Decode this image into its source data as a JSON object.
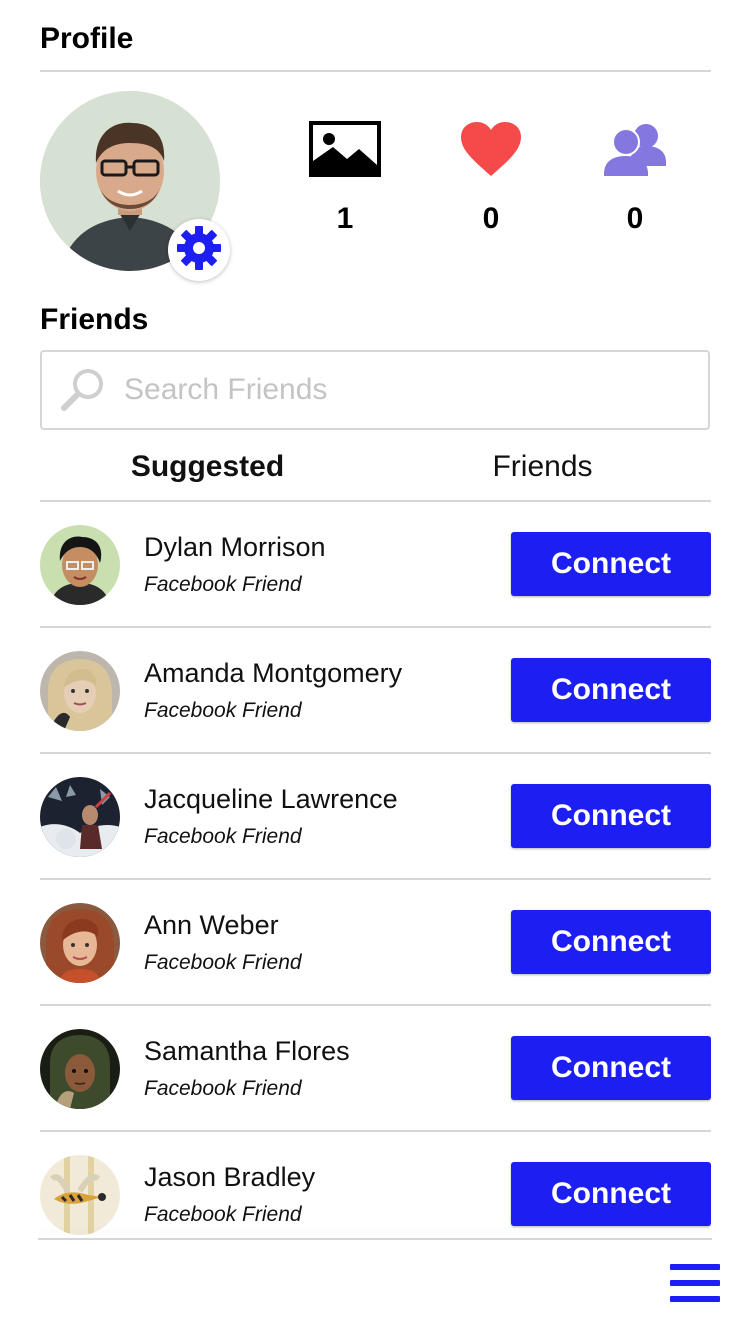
{
  "header": {
    "title": "Profile"
  },
  "profile": {
    "stats": [
      {
        "name": "photos",
        "icon": "image-icon",
        "value": "1"
      },
      {
        "name": "likes",
        "icon": "heart-icon",
        "value": "0",
        "color": "#f44a4a"
      },
      {
        "name": "friends",
        "icon": "users-icon",
        "value": "0",
        "color": "#8477e0"
      }
    ]
  },
  "friends_section": {
    "title": "Friends",
    "search": {
      "placeholder": "Search Friends",
      "value": ""
    },
    "tabs": [
      {
        "label": "Suggested",
        "active": true
      },
      {
        "label": "Friends",
        "active": false
      }
    ],
    "list": [
      {
        "name": "Dylan Morrison",
        "subtitle": "Facebook Friend",
        "button": "Connect"
      },
      {
        "name": "Amanda Montgomery",
        "subtitle": "Facebook Friend",
        "button": "Connect"
      },
      {
        "name": "Jacqueline Lawrence",
        "subtitle": "Facebook Friend",
        "button": "Connect"
      },
      {
        "name": "Ann Weber",
        "subtitle": "Facebook Friend",
        "button": "Connect"
      },
      {
        "name": "Samantha Flores",
        "subtitle": "Facebook Friend",
        "button": "Connect"
      },
      {
        "name": "Jason Bradley",
        "subtitle": "Facebook Friend",
        "button": "Connect"
      }
    ]
  },
  "colors": {
    "accent": "#1d1ff2",
    "divider": "#d6d6d6"
  },
  "nav": {
    "menu_icon": "hamburger-menu-icon"
  }
}
